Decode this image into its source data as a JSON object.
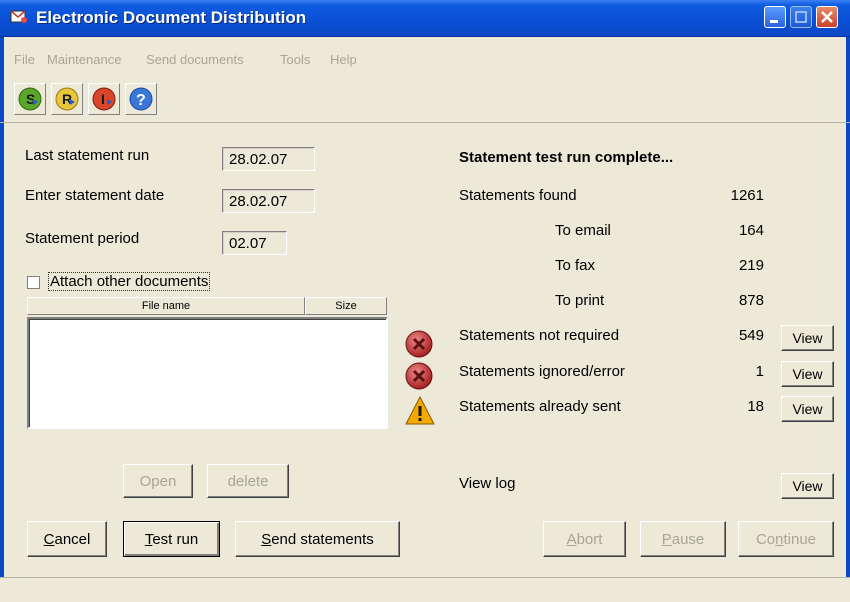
{
  "window": {
    "title": "Electronic Document Distribution"
  },
  "menu": [
    {
      "label": "File"
    },
    {
      "label": "Maintenance"
    },
    {
      "label": "Send documents"
    },
    {
      "label": "Tools"
    },
    {
      "label": "Help"
    }
  ],
  "toolbar": {
    "s_label": "S",
    "r_label": "R",
    "i_label": "I",
    "help_label": "?"
  },
  "form": {
    "last_run_label": "Last statement run",
    "last_run_value": "28.02.07",
    "enter_date_label": "Enter statement date",
    "enter_date_value": "28.02.07",
    "period_label": "Statement period",
    "period_value": "02.07",
    "attach_label": "Attach other documents"
  },
  "file_table": {
    "col_name": "File name",
    "col_size": "Size"
  },
  "file_buttons": {
    "open": "Open",
    "delete": "delete"
  },
  "results": {
    "heading": "Statement test run complete...",
    "found_label": "Statements found",
    "found_value": "1261",
    "email_label": "To email",
    "email_value": "164",
    "fax_label": "To fax",
    "fax_value": "219",
    "print_label": "To print",
    "print_value": "878",
    "not_required_label": "Statements not required",
    "not_required_value": "549",
    "ignored_label": "Statements ignored/error",
    "ignored_value": "1",
    "sent_label": "Statements already sent",
    "sent_value": "18",
    "view_label": "View",
    "log_label": "View log"
  },
  "actions": {
    "cancel_c": "C",
    "cancel_rest": "ancel",
    "test_t": "T",
    "test_rest": "est run",
    "send_s": "S",
    "send_rest": "end statements",
    "abort_a": "A",
    "abort_rest": "bort",
    "pause_p": "P",
    "pause_rest": "ause",
    "continue_a": "Co",
    "continue_n": "n",
    "continue_b": "tinue"
  },
  "colors": {
    "accent": "#0b48c4",
    "error": "#c8393a",
    "warning": "#f2a900"
  }
}
